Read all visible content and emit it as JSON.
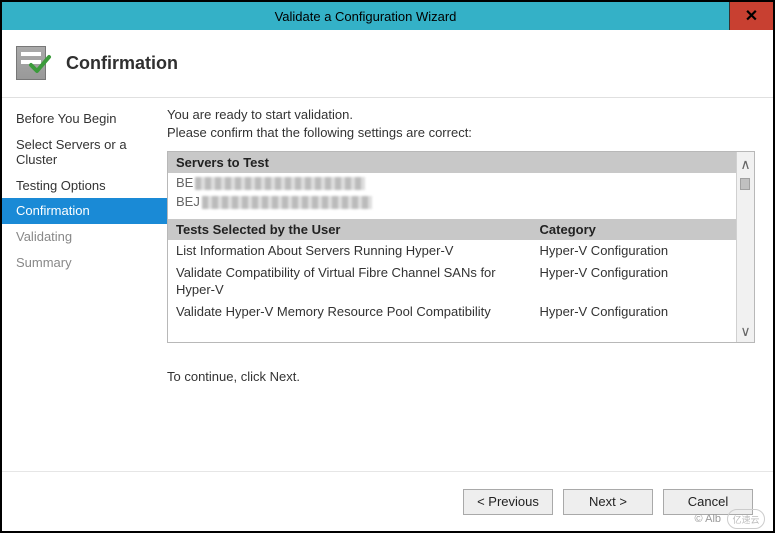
{
  "window": {
    "title": "Validate a Configuration Wizard",
    "close_glyph": "✕"
  },
  "header": {
    "title": "Confirmation"
  },
  "nav": {
    "items": [
      {
        "label": "Before You Begin",
        "state": "normal"
      },
      {
        "label": "Select Servers or a Cluster",
        "state": "normal"
      },
      {
        "label": "Testing Options",
        "state": "normal"
      },
      {
        "label": "Confirmation",
        "state": "selected"
      },
      {
        "label": "Validating",
        "state": "dim"
      },
      {
        "label": "Summary",
        "state": "dim"
      }
    ]
  },
  "content": {
    "intro_line1": "You are ready to start validation.",
    "intro_line2": "Please confirm that the following settings are correct:",
    "servers_heading": "Servers to Test",
    "servers": [
      {
        "prefix": "BE"
      },
      {
        "prefix": "BEJ"
      }
    ],
    "tests_heading_name": "Tests Selected by the User",
    "tests_heading_cat": "Category",
    "tests": [
      {
        "name": "List Information About Servers Running Hyper-V",
        "category": "Hyper-V Configuration"
      },
      {
        "name": "Validate Compatibility of Virtual Fibre Channel SANs for Hyper-V",
        "category": "Hyper-V Configuration"
      },
      {
        "name": "Validate Hyper-V Memory Resource Pool Compatibility",
        "category": "Hyper-V Configuration"
      }
    ],
    "continue_text": "To continue, click Next."
  },
  "footer": {
    "previous": "< Previous",
    "next": "Next >",
    "cancel": "Cancel"
  },
  "watermark": {
    "text": "© Alb",
    "logo": "亿速云"
  }
}
